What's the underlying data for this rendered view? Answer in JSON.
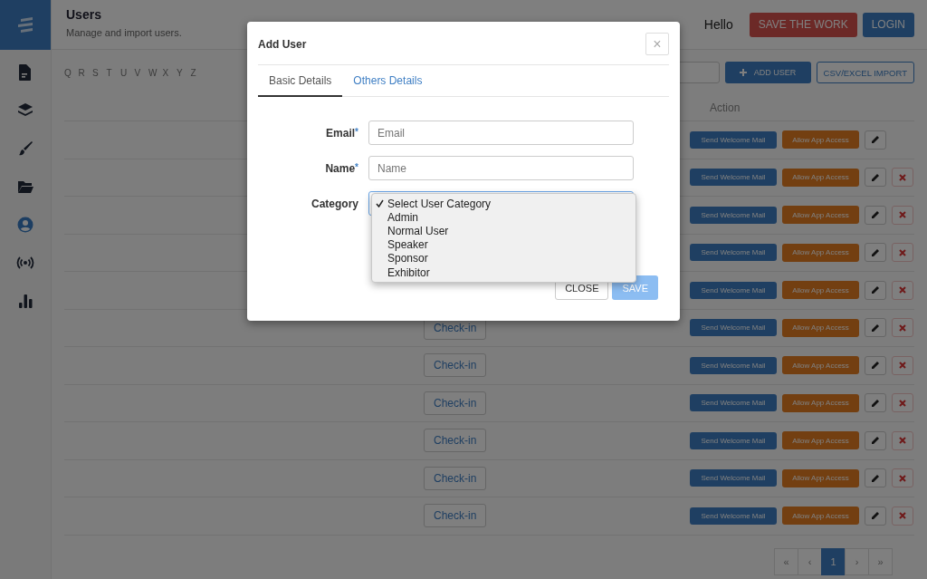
{
  "header": {
    "title": "Users",
    "subtitle": "Manage and import users.",
    "greeting": "Hello",
    "save_button": "SAVE THE WORK",
    "login_button": "LOGIN"
  },
  "sidebar": {
    "items": [
      {
        "kind": "document",
        "selected": false
      },
      {
        "kind": "layers",
        "selected": false
      },
      {
        "kind": "brush",
        "selected": false
      },
      {
        "kind": "folder",
        "selected": false
      },
      {
        "kind": "user",
        "selected": true
      },
      {
        "kind": "broadcast",
        "selected": false
      },
      {
        "kind": "chart",
        "selected": false
      }
    ]
  },
  "toolbar": {
    "letters": [
      "Q",
      "R",
      "S",
      "T",
      "U",
      "V",
      "W",
      "X",
      "Y",
      "Z"
    ],
    "add_user_button": "ADD USER",
    "import_button": "CSV/EXCEL IMPORT"
  },
  "table": {
    "action_header": "Action",
    "rows": [
      {
        "check_in": null,
        "mail_button": "Send Welcome Mail",
        "access_button": "Allow App Access",
        "has_delete": false
      },
      {
        "check_in": null,
        "mail_button": "Send Welcome Mail",
        "access_button": "Allow App Access",
        "has_delete": true
      },
      {
        "check_in": null,
        "mail_button": "Send Welcome Mail",
        "access_button": "Allow App Access",
        "has_delete": true
      },
      {
        "check_in": null,
        "mail_button": "Send Welcome Mail",
        "access_button": "Allow App Access",
        "has_delete": true
      },
      {
        "check_in": null,
        "mail_button": "Send Welcome Mail",
        "access_button": "Allow App Access",
        "has_delete": true
      },
      {
        "check_in": "Check-in",
        "mail_button": "Send Welcome Mail",
        "access_button": "Allow App Access",
        "has_delete": true
      },
      {
        "check_in": "Check-in",
        "mail_button": "Send Welcome Mail",
        "access_button": "Allow App Access",
        "has_delete": true
      },
      {
        "check_in": "Check-in",
        "mail_button": "Send Welcome Mail",
        "access_button": "Allow App Access",
        "has_delete": true
      },
      {
        "check_in": "Check-in",
        "mail_button": "Send Welcome Mail",
        "access_button": "Allow App Access",
        "has_delete": true
      },
      {
        "check_in": "Check-in",
        "mail_button": "Send Welcome Mail",
        "access_button": "Allow App Access",
        "has_delete": true
      },
      {
        "check_in": "Check-in",
        "mail_button": "Send Welcome Mail",
        "access_button": "Allow App Access",
        "has_delete": true
      }
    ]
  },
  "pagination": [
    {
      "label": "«",
      "selected": false
    },
    {
      "label": "‹",
      "selected": false
    },
    {
      "label": "1",
      "selected": true
    },
    {
      "label": "›",
      "selected": false
    },
    {
      "label": "»",
      "selected": false
    }
  ],
  "modal": {
    "title": "Add User",
    "close_icon": "×",
    "tabs": [
      {
        "label": "Basic Details",
        "selected": true
      },
      {
        "label": "Others Details",
        "selected": false
      }
    ],
    "fields": [
      {
        "kind": "text",
        "label": "Email",
        "required_mark": "*",
        "placeholder": "Email"
      },
      {
        "kind": "text",
        "label": "Name",
        "required_mark": "*",
        "placeholder": "Name"
      },
      {
        "kind": "select",
        "label": "Category"
      }
    ],
    "dropdown_options": [
      {
        "label": "Select User Category",
        "selected": true
      },
      {
        "label": "Admin",
        "selected": false
      },
      {
        "label": "Normal User",
        "selected": false
      },
      {
        "label": "Speaker",
        "selected": false
      },
      {
        "label": "Sponsor",
        "selected": false
      },
      {
        "label": "Exhibitor",
        "selected": false
      }
    ],
    "close_button": "CLOSE",
    "save_button": {
      "label": "SAVE",
      "disabled": true
    }
  }
}
